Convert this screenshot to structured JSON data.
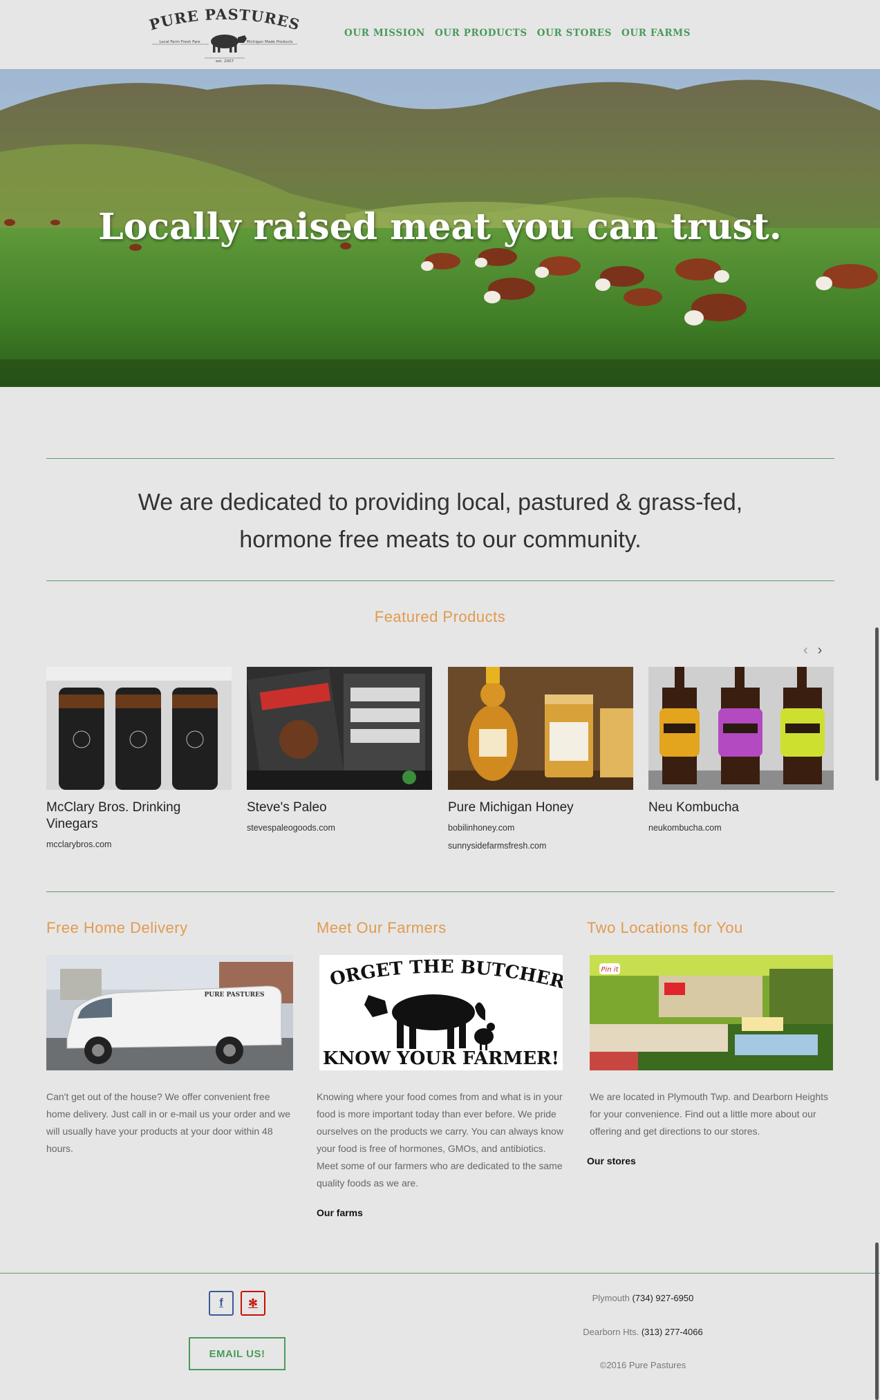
{
  "brand": {
    "name": "PURE PASTURES",
    "tagline_left": "Local Farm Fresh Fare",
    "tagline_right": "Michigan Made Products",
    "est": "est. 2007"
  },
  "nav": {
    "items": [
      "OUR MISSION",
      "OUR PRODUCTS",
      "OUR STORES",
      "OUR FARMS"
    ]
  },
  "hero": {
    "headline": "Locally raised meat you can trust."
  },
  "mission": {
    "line1": "We are dedicated to providing local, pastured & grass-fed,",
    "line2": "hormone free meats to our community."
  },
  "featured": {
    "title": "Featured Products",
    "prev_icon": "chevron-left-icon",
    "next_icon": "chevron-right-icon",
    "products": [
      {
        "name": "McClary Bros. Drinking Vinegars",
        "links": [
          "mcclarybros.com"
        ]
      },
      {
        "name": "Steve's Paleo",
        "links": [
          "stevespaleogoods.com"
        ]
      },
      {
        "name": "Pure Michigan Honey",
        "links": [
          "bobilinhoney.com",
          "sunnysidefarmsfresh.com"
        ]
      },
      {
        "name": "Neu Kombucha",
        "links": [
          "neukombucha.com"
        ]
      }
    ]
  },
  "columns": [
    {
      "title": "Free Home Delivery",
      "text": "Can't get out of the house? We offer convenient free home delivery. Just call in or e-mail us your order and we will usually have your products at your door within 48 hours.",
      "van_label": "PURE PASTURES"
    },
    {
      "title": "Meet Our Farmers",
      "sign_top": "FORGET THE BUTCHER",
      "sign_bottom": "KNOW YOUR FARMER!",
      "text": "Knowing where your food comes from and what is in your food is more important today than ever before. We pride ourselves on the products we carry. You can always know your food is free of hormones, GMOs, and antibiotics. Meet some of our farmers who are dedicated to the same quality foods as we are.",
      "link": "Our farms"
    },
    {
      "title": "Two Locations for You",
      "store_sign": "Pin it",
      "text": "We are located in Plymouth Twp. and Dearborn Heights for your convenience.  Find out a little more about our offering and get directions to our stores.",
      "link": "Our stores"
    }
  ],
  "footer": {
    "facebook_icon": "f",
    "yelp_icon": "✻",
    "email_button": "EMAIL US!",
    "plymouth_label": "Plymouth",
    "plymouth_phone": "(734) 927-6950",
    "dearborn_label": "Dearborn Hts.",
    "dearborn_phone": "(313) 277-4066",
    "copyright": "©2016 Pure Pastures"
  },
  "colors": {
    "accent_green": "#4a9a5c",
    "accent_orange": "#e29a4f",
    "background": "#e6e6e6"
  }
}
